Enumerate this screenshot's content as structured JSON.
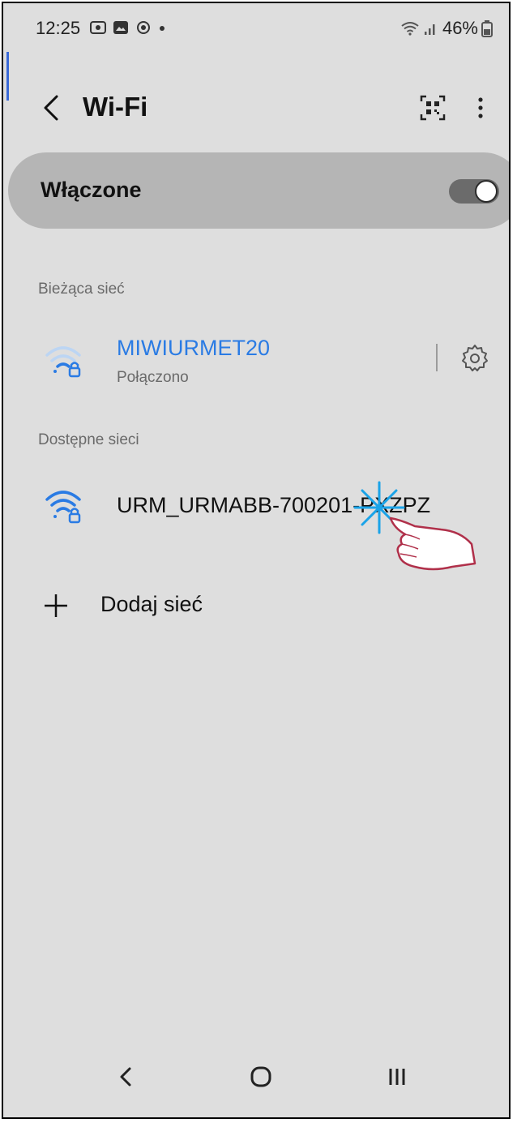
{
  "status_bar": {
    "time": "12:25",
    "battery_percent": "46%",
    "left_icons": [
      "screen-record-icon",
      "gallery-icon",
      "sync-icon",
      "dot-icon"
    ],
    "right_icons": [
      "wifi-status-icon",
      "signal-icon",
      "battery-icon"
    ]
  },
  "header": {
    "title": "Wi-Fi",
    "back_icon": "chevron-left-icon",
    "qr_icon": "qr-code-icon",
    "more_icon": "more-vertical-icon"
  },
  "toggle": {
    "label": "Włączone",
    "state": "on"
  },
  "current_network": {
    "section_title": "Bieżąca sieć",
    "name": "MIWIURMET20",
    "status": "Połączono",
    "settings_icon": "gear-icon"
  },
  "available_networks": {
    "section_title": "Dostępne sieci",
    "items": [
      {
        "name": "URM_URMABB-700201-PXZPZ",
        "icon": "wifi-lock-icon"
      }
    ]
  },
  "add_network": {
    "label": "Dodaj sieć",
    "icon": "plus-icon"
  },
  "nav_bar": {
    "items": [
      "back-icon",
      "home-icon",
      "recent-apps-icon"
    ]
  },
  "colors": {
    "accent": "#2a7be4",
    "background": "#dedede",
    "card": "#b5b5b5",
    "switch_track": "#6b6b6b"
  }
}
